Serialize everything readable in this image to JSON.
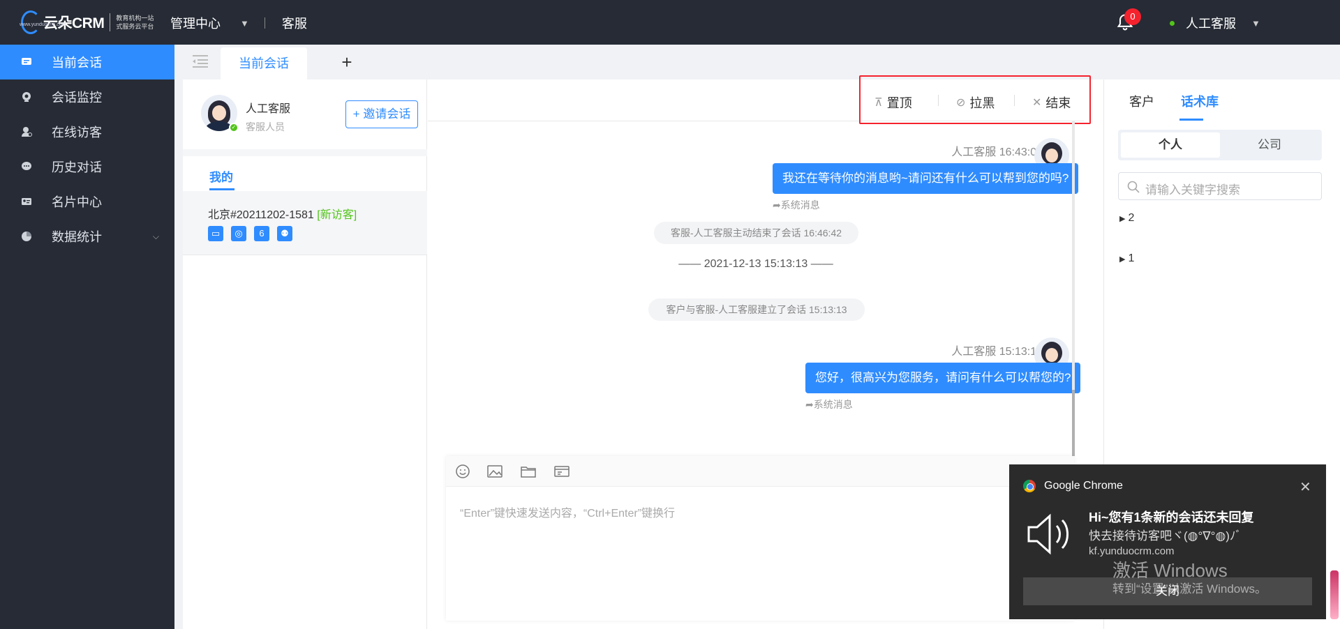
{
  "topbar": {
    "logo_text": "云朵CRM",
    "logo_url": "www.yunduocrm.com",
    "logo_slogan_1": "教育机构一站",
    "logo_slogan_2": "式服务云平台",
    "nav_admin": "管理中心",
    "nav_service": "客服",
    "notification_count": "0",
    "user_name": "人工客服"
  },
  "sidebar": {
    "items": [
      {
        "label": "当前会话",
        "icon": "chat-icon"
      },
      {
        "label": "会话监控",
        "icon": "monitor-icon"
      },
      {
        "label": "在线访客",
        "icon": "visitor-icon"
      },
      {
        "label": "历史对话",
        "icon": "history-icon"
      },
      {
        "label": "名片中心",
        "icon": "card-icon"
      },
      {
        "label": "数据统计",
        "icon": "pie-chart-icon"
      }
    ]
  },
  "tabs": {
    "current": "当前会话",
    "add": "+"
  },
  "agent": {
    "name": "人工客服",
    "role": "客服人员",
    "invite_button": "+ 邀请会话"
  },
  "conversations": {
    "my_tab": "我的",
    "items": [
      {
        "title": "北京#20211202-1581",
        "tag": "[新访客]",
        "badge_count": "6"
      }
    ]
  },
  "chat_toolbar": {
    "pin": "置顶",
    "block": "拉黑",
    "end": "结束"
  },
  "messages": {
    "msg1_meta": "人工客服 16:43:04",
    "msg1_text": "我还在等待你的消息哟~请问还有什么可以帮到您的吗?",
    "msg1_sys": "系统消息",
    "chip1": "客服-人工客服主动结束了会话 16:46:42",
    "dateline": "—— 2021-12-13 15:13:13 ——",
    "chip2": "客户与客服-人工客服建立了会话 15:13:13",
    "msg2_meta": "人工客服 15:13:14",
    "msg2_text": "您好，很高兴为您服务，请问有什么可以帮您的?",
    "msg2_sys": "系统消息"
  },
  "input": {
    "placeholder": "“Enter”键快速发送内容，“Ctrl+Enter”键换行"
  },
  "right_panel": {
    "tab_customer": "客户",
    "tab_scripts": "话术库",
    "seg_personal": "个人",
    "seg_company": "公司",
    "search_placeholder": "请输入关键字搜索",
    "tree": [
      "2",
      "1"
    ]
  },
  "notification": {
    "app": "Google Chrome",
    "title": "Hi~您有1条新的会话还未回复",
    "body": "快去接待访客吧ヾ(◍°∇°◍)ﾉﾞ",
    "site": "kf.yunduocrm.com",
    "close_button": "关闭"
  },
  "watermark": {
    "line1": "激活 Windows",
    "line2": "转到“设置”以激活 Windows。"
  },
  "colors": {
    "accent": "#2f8cff",
    "sidebar_bg": "#262b35",
    "highlight_border": "#f5222d"
  }
}
